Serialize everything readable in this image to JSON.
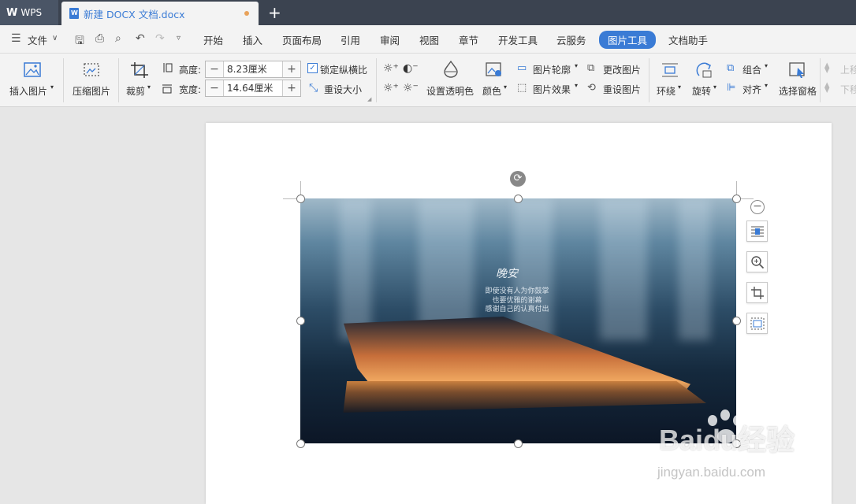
{
  "tabbar": {
    "app_label": "WPS",
    "doc_tab": "新建 DOCX 文档.docx",
    "new_tab_icon": "plus-icon"
  },
  "menubar": {
    "file": "文件",
    "items": [
      "开始",
      "插入",
      "页面布局",
      "引用",
      "审阅",
      "视图",
      "章节",
      "开发工具",
      "云服务",
      "图片工具",
      "文档助手"
    ],
    "active": "图片工具"
  },
  "ribbon": {
    "insert_picture": "插入图片",
    "compress_picture": "压缩图片",
    "crop": "裁剪",
    "height_label": "高度:",
    "height_value": "8.23厘米",
    "width_label": "宽度:",
    "width_value": "14.64厘米",
    "lock_ratio": "锁定纵横比",
    "lock_ratio_checked": true,
    "reset_size": "重设大小",
    "set_transparent": "设置透明色",
    "color": "颜色",
    "picture_outline": "图片轮廓",
    "picture_effect": "图片效果",
    "change_picture": "更改图片",
    "reset_picture": "重设图片",
    "wrap": "环绕",
    "rotate": "旋转",
    "group": "组合",
    "align": "对齐",
    "select_pane": "选择窗格",
    "bring_forward": "上移",
    "send_backward": "下移"
  },
  "image": {
    "title_script": "晚安",
    "caption_lines": [
      "即使没有人为你鼓掌",
      "也要优雅的谢幕",
      "感谢自己的认真付出"
    ]
  },
  "watermark": {
    "brand": "Baidu经验",
    "url": "jingyan.baidu.com"
  },
  "colors": {
    "accent": "#3a7bd5",
    "tabbar": "#3b4350",
    "ribbon": "#f3f3f3"
  }
}
